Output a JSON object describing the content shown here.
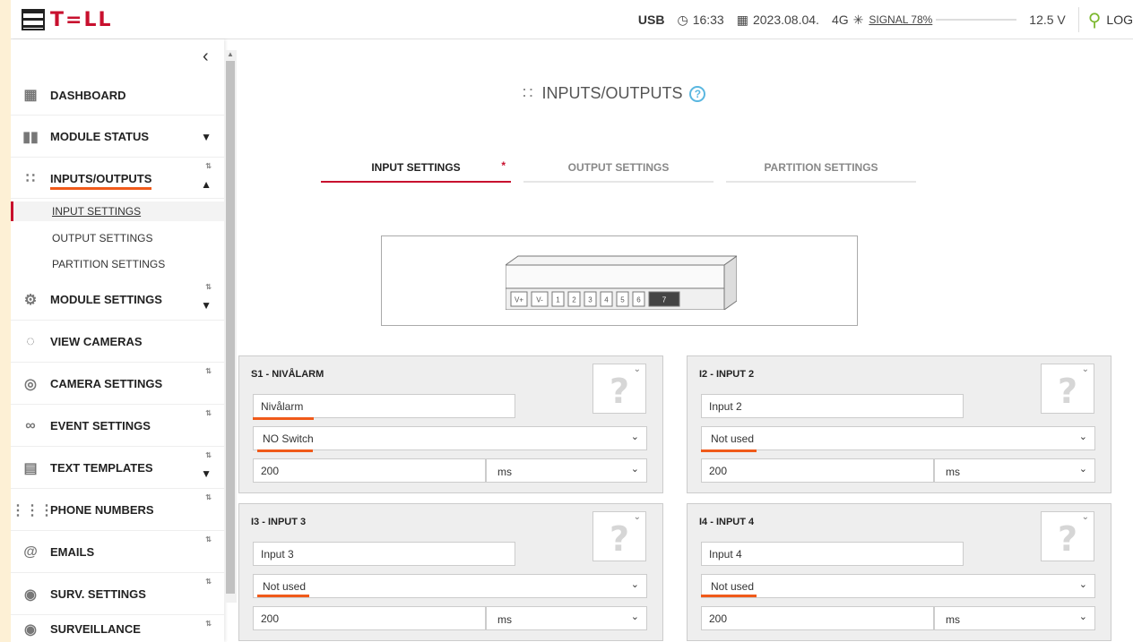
{
  "topbar": {
    "logo": "T=LL",
    "usb": "USB",
    "time": "16:33",
    "date": "2023.08.04.",
    "network": "4G",
    "signal": "SIGNAL 78%",
    "voltage": "12.5 V",
    "login": "LOG"
  },
  "sidebar": {
    "items": [
      {
        "label": "DASHBOARD"
      },
      {
        "label": "MODULE STATUS"
      },
      {
        "label": "INPUTS/OUTPUTS"
      },
      {
        "label": "MODULE SETTINGS"
      },
      {
        "label": "VIEW CAMERAS"
      },
      {
        "label": "CAMERA SETTINGS"
      },
      {
        "label": "EVENT SETTINGS"
      },
      {
        "label": "TEXT TEMPLATES"
      },
      {
        "label": "PHONE NUMBERS"
      },
      {
        "label": "EMAILS"
      },
      {
        "label": "SURV. SETTINGS"
      },
      {
        "label": "SURVEILLANCE"
      }
    ],
    "sub": [
      "INPUT SETTINGS",
      "OUTPUT SETTINGS",
      "PARTITION SETTINGS"
    ]
  },
  "main": {
    "title": "INPUTS/OUTPUTS",
    "tabs": [
      "INPUT SETTINGS",
      "OUTPUT SETTINGS",
      "PARTITION SETTINGS"
    ],
    "tab_marker": "*",
    "terminals": [
      "V+",
      "V-",
      "1",
      "2",
      "3",
      "4",
      "5",
      "6",
      "7"
    ],
    "cards": [
      {
        "title": "S1 - NIVÅLARM",
        "name": "Nivålarm",
        "mode": "NO Switch",
        "delay": "200",
        "unit": "ms"
      },
      {
        "title": "I2 - INPUT 2",
        "name": "Input 2",
        "mode": "Not used",
        "delay": "200",
        "unit": "ms"
      },
      {
        "title": "I3 - INPUT 3",
        "name": "Input 3",
        "mode": "Not used",
        "delay": "200",
        "unit": "ms"
      },
      {
        "title": "I4 - INPUT 4",
        "name": "Input 4",
        "mode": "Not used",
        "delay": "200",
        "unit": "ms"
      }
    ]
  },
  "colors": {
    "accent": "#c8102e",
    "highlight": "#f05a1a",
    "help": "#5ab7e0",
    "key": "#7cb82f"
  }
}
